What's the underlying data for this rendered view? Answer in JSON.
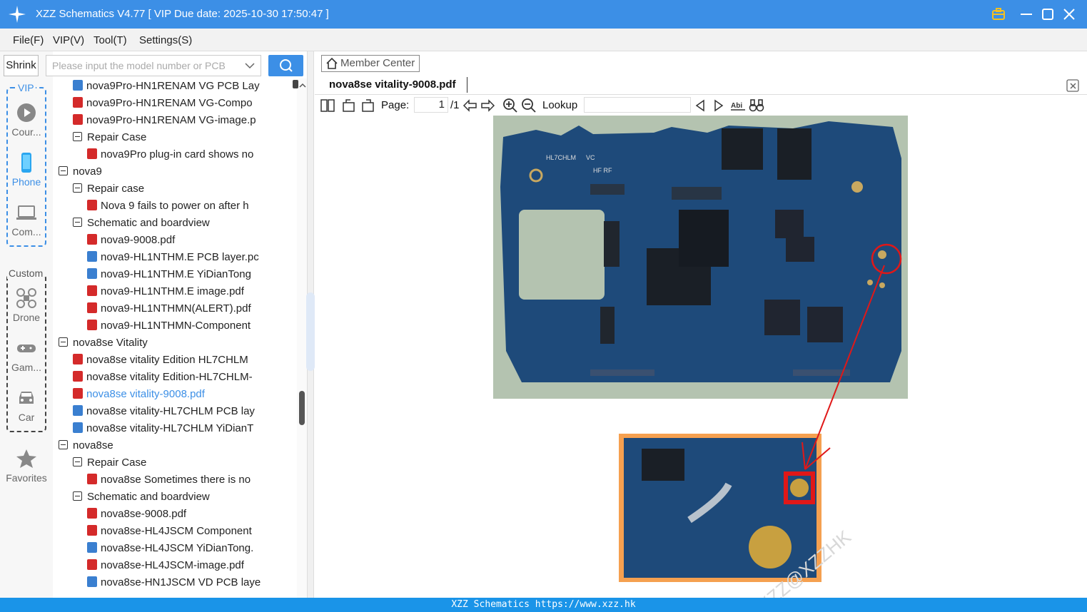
{
  "window": {
    "title": "XZZ Schematics V4.77 [ VIP Due date: 2025-10-30 17:50:47 ]"
  },
  "menu": [
    {
      "label": "File(F)"
    },
    {
      "label": "VIP(V)"
    },
    {
      "label": "Tool(T)"
    },
    {
      "label": "Settings(S)"
    }
  ],
  "sidebar": {
    "shrink_label": "Shrink",
    "search_placeholder": "Please input the model number or PCB",
    "vip_group_label": "VIP",
    "custom_group_label": "Custom",
    "vip_items": [
      {
        "label": "Cour...",
        "icon": "play-circle-icon"
      },
      {
        "label": "Phone",
        "icon": "phone-icon"
      },
      {
        "label": "Com...",
        "icon": "laptop-icon"
      }
    ],
    "custom_items": [
      {
        "label": "Drone",
        "icon": "drone-icon"
      },
      {
        "label": "Gam...",
        "icon": "gamepad-icon"
      },
      {
        "label": "Car",
        "icon": "car-icon"
      }
    ],
    "favorites_label": "Favorites"
  },
  "tree": [
    {
      "level": 2,
      "kind": "pcb",
      "label": "nova9Pro-HN1RENAM VG PCB Lay"
    },
    {
      "level": 2,
      "kind": "pdf",
      "label": "nova9Pro-HN1RENAM VG-Compo"
    },
    {
      "level": 2,
      "kind": "pdf",
      "label": "nova9Pro-HN1RENAM VG-image.p"
    },
    {
      "level": 2,
      "kind": "folder",
      "label": "Repair Case"
    },
    {
      "level": 3,
      "kind": "pdf",
      "label": "nova9Pro plug-in card shows no"
    },
    {
      "level": 1,
      "kind": "folder",
      "label": "nova9"
    },
    {
      "level": 2,
      "kind": "folder",
      "label": "Repair case"
    },
    {
      "level": 3,
      "kind": "pdf",
      "label": "Nova 9 fails to power on after h"
    },
    {
      "level": 2,
      "kind": "folder",
      "label": "Schematic and boardview"
    },
    {
      "level": 3,
      "kind": "pdf",
      "label": "nova9-9008.pdf"
    },
    {
      "level": 3,
      "kind": "pcb",
      "label": "nova9-HL1NTHM.E PCB layer.pc"
    },
    {
      "level": 3,
      "kind": "pcb",
      "label": "nova9-HL1NTHM.E YiDianTong"
    },
    {
      "level": 3,
      "kind": "pdf",
      "label": "nova9-HL1NTHM.E image.pdf"
    },
    {
      "level": 3,
      "kind": "pdf",
      "label": "nova9-HL1NTHMN(ALERT).pdf"
    },
    {
      "level": 3,
      "kind": "pdf",
      "label": "nova9-HL1NTHMN-Component"
    },
    {
      "level": 1,
      "kind": "folder",
      "label": "nova8se Vitality"
    },
    {
      "level": 2,
      "kind": "pdf",
      "label": "nova8se vitality Edition HL7CHLM"
    },
    {
      "level": 2,
      "kind": "pdf",
      "label": "nova8se vitality Edition-HL7CHLM-"
    },
    {
      "level": 2,
      "kind": "pdf",
      "label": "nova8se vitality-9008.pdf",
      "selected": true
    },
    {
      "level": 2,
      "kind": "pcb",
      "label": "nova8se vitality-HL7CHLM PCB lay"
    },
    {
      "level": 2,
      "kind": "pcb",
      "label": "nova8se vitality-HL7CHLM YiDianT"
    },
    {
      "level": 1,
      "kind": "folder",
      "label": "nova8se"
    },
    {
      "level": 2,
      "kind": "folder",
      "label": "Repair Case"
    },
    {
      "level": 3,
      "kind": "pdf",
      "label": "nova8se Sometimes there is no"
    },
    {
      "level": 2,
      "kind": "folder",
      "label": "Schematic and boardview"
    },
    {
      "level": 3,
      "kind": "pdf",
      "label": "nova8se-9008.pdf"
    },
    {
      "level": 3,
      "kind": "pdf",
      "label": "nova8se-HL4JSCM Component"
    },
    {
      "level": 3,
      "kind": "pcb",
      "label": "nova8se-HL4JSCM YiDianTong."
    },
    {
      "level": 3,
      "kind": "pdf",
      "label": "nova8se-HL4JSCM-image.pdf"
    },
    {
      "level": 3,
      "kind": "pcb",
      "label": "nova8se-HN1JSCM VD PCB laye"
    }
  ],
  "viewer": {
    "member_center_label": "Member Center",
    "tab_label": "nova8se vitality-9008.pdf",
    "page_label": "Page:",
    "page_current": "1",
    "page_total": "/1",
    "lookup_label": "Lookup",
    "lookup_value": "",
    "board_silkscreen": [
      "HL7CHLM",
      "VC",
      "HF RF"
    ],
    "watermark": "XZZ@XZZHK"
  },
  "status": {
    "text": "XZZ Schematics https://www.xzz.hk"
  },
  "colors": {
    "accent": "#3c8fe6",
    "status_bar": "#1a94e8",
    "pdf_icon": "#d42a2a",
    "pcb_icon": "#3a7fd0",
    "selected_text": "#3c8fe6",
    "highlight_red": "#e01818",
    "crop_frame": "#f5a050"
  }
}
